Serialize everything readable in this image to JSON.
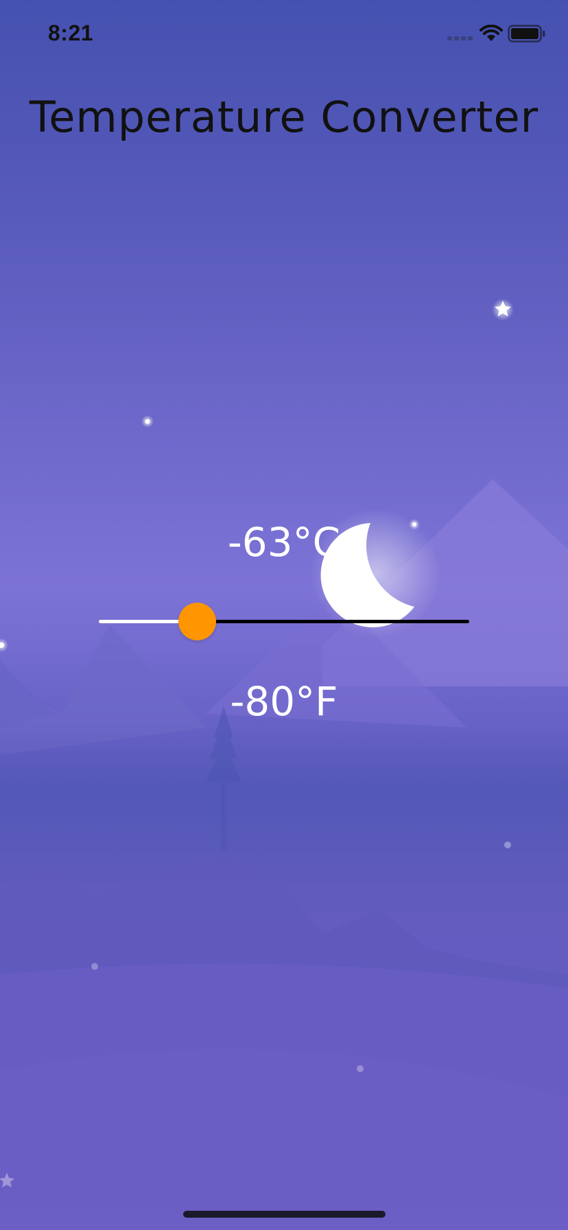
{
  "status_bar": {
    "time": "8:21",
    "icons": [
      "signal-icon",
      "wifi-icon",
      "battery-icon"
    ]
  },
  "app": {
    "title": "Temperature Converter"
  },
  "converter": {
    "celsius": "-63°C",
    "fahrenheit": "-80°F",
    "slider": {
      "value_fraction": 0.265,
      "min_track_color": "#ffffff",
      "max_track_color": "#000000",
      "thumb_color": "#ff9500"
    }
  },
  "background": {
    "scene": "night-mountains",
    "sky_color": "#4551b0",
    "moon_color": "#ffffff"
  }
}
